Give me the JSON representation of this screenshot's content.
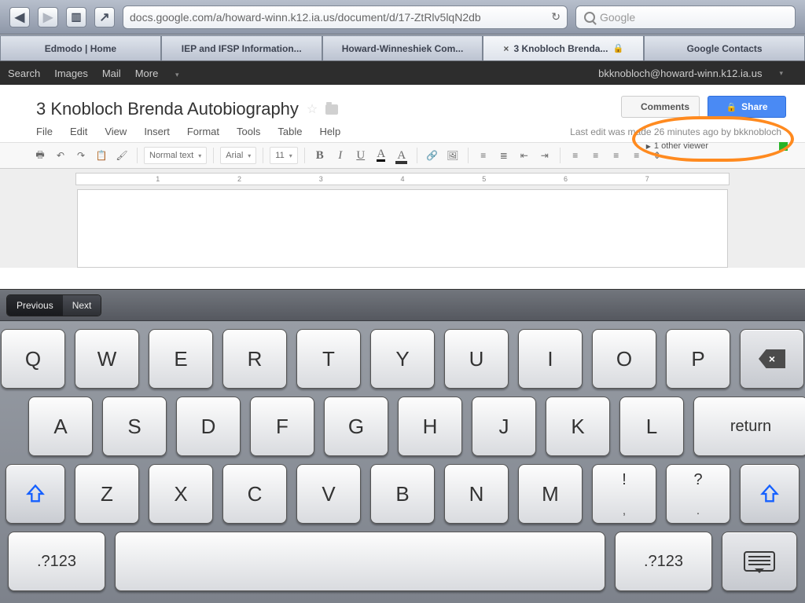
{
  "browser": {
    "url": "docs.google.com/a/howard-winn.k12.ia.us/document/d/17-ZtRlv5lqN2db",
    "search_placeholder": "Google"
  },
  "tabs": [
    {
      "label": "Edmodo | Home"
    },
    {
      "label": "IEP and IFSP Information..."
    },
    {
      "label": "Howard-Winneshiek Com..."
    },
    {
      "label": "3 Knobloch Brenda...",
      "active": true,
      "closeable": true,
      "locked": true
    },
    {
      "label": "Google Contacts"
    }
  ],
  "gbar": {
    "items": [
      "Search",
      "Images",
      "Mail",
      "More"
    ],
    "user": "bkknobloch@howard-winn.k12.ia.us"
  },
  "doc": {
    "title": "3 Knobloch Brenda Autobiography",
    "menus": [
      "File",
      "Edit",
      "View",
      "Insert",
      "Format",
      "Tools",
      "Table",
      "Help"
    ],
    "status": "Last edit was made 26 minutes ago by bkknobloch",
    "comments": "Comments",
    "share": "Share",
    "viewers": "1 other viewer"
  },
  "toolbar": {
    "style": "Normal text",
    "font": "Arial",
    "size": "11"
  },
  "ruler": [
    "1",
    "2",
    "3",
    "4",
    "5",
    "6",
    "7"
  ],
  "form_assist": {
    "prev": "Previous",
    "next": "Next"
  },
  "kb": {
    "row1": [
      "Q",
      "W",
      "E",
      "R",
      "T",
      "Y",
      "U",
      "I",
      "O",
      "P"
    ],
    "row2": [
      "A",
      "S",
      "D",
      "F",
      "G",
      "H",
      "J",
      "K",
      "L"
    ],
    "row3": [
      "Z",
      "X",
      "C",
      "V",
      "B",
      "N",
      "M"
    ],
    "punct": [
      {
        "top": "!",
        "sub": ","
      },
      {
        "top": "?",
        "sub": "."
      }
    ],
    "return": "return",
    "numkey": ".?123"
  }
}
